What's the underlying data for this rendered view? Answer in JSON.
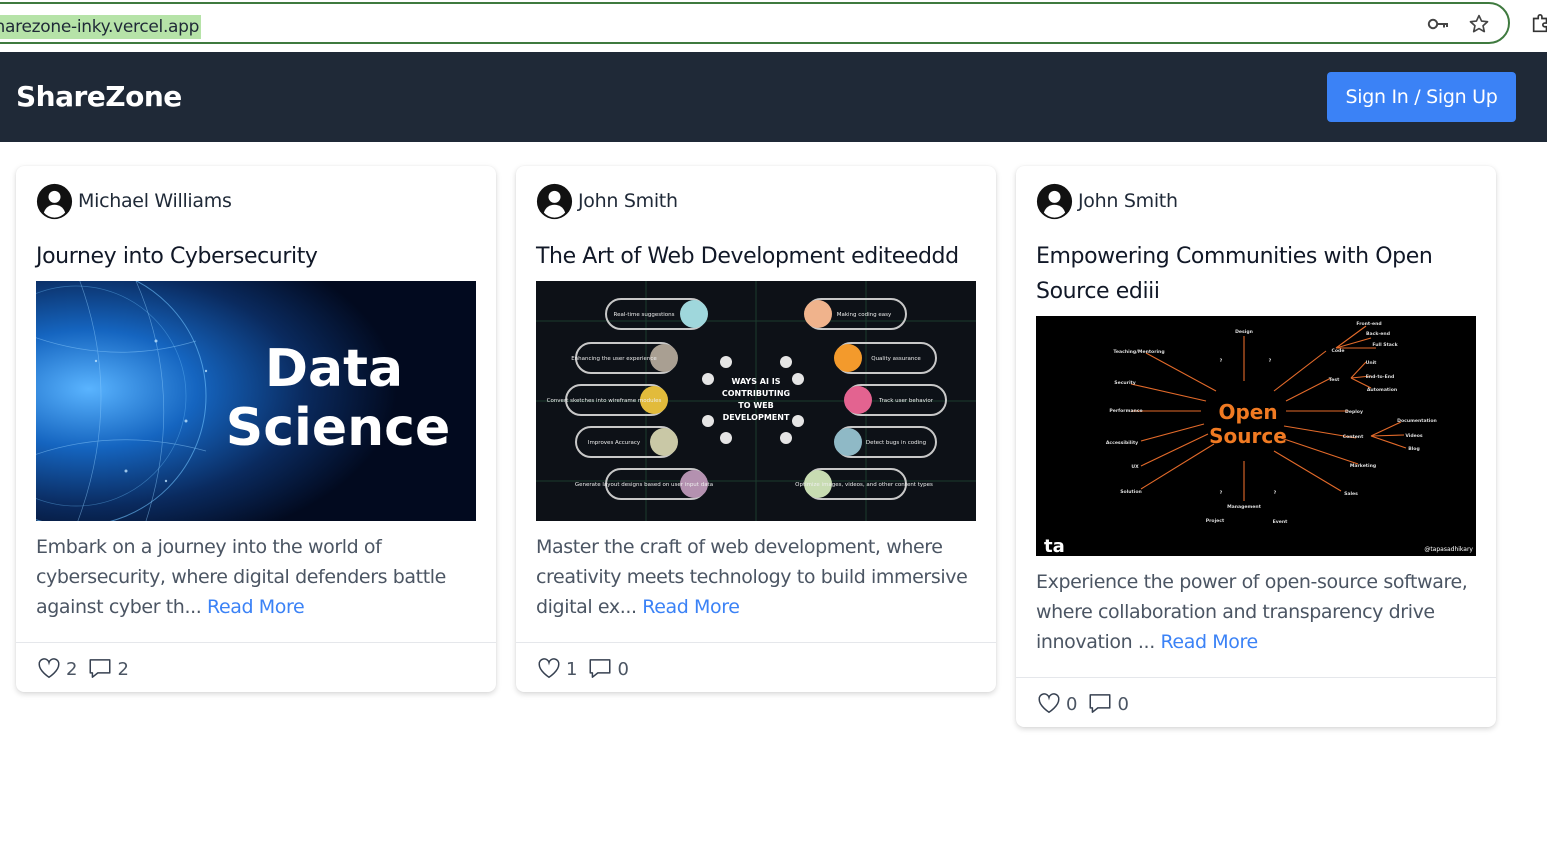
{
  "browser": {
    "url": "sharezone-inky.vercel.app",
    "icons": [
      "key-icon",
      "star-icon",
      "extensions-icon"
    ]
  },
  "header": {
    "brand": "ShareZone",
    "signin_label": "Sign In / Sign Up",
    "colors": {
      "background": "#1f2937",
      "button": "#3b82f6"
    }
  },
  "posts": [
    {
      "author": "Michael Williams",
      "title": "Journey into Cybersecurity",
      "image": {
        "headline_1": "Data",
        "headline_2": "Science"
      },
      "excerpt": "Embark on a journey into the world of cybersecurity, where digital defenders battle against cyber th...",
      "read_more": "Read More",
      "likes": "2",
      "comments": "2"
    },
    {
      "author": "John Smith",
      "title": "The Art of Web Development editeeddd",
      "image": {
        "center_1": "WAYS AI IS",
        "center_2": "CONTRIBUTING",
        "center_3": "TO WEB",
        "center_4": "DEVELOPMENT",
        "left_labels": [
          "Real-time suggestions",
          "Enhancing the user experience",
          "Convert sketches into wireframe modules",
          "Improves Accuracy",
          "Generate layout designs based on user input data"
        ],
        "right_labels": [
          "Making coding easy",
          "Quality assurance",
          "Track user behavior",
          "Detect bugs in coding",
          "Optimize images, videos, and other content types"
        ]
      },
      "excerpt": "Master the craft of web development, where creativity meets technology to build immersive digital ex...",
      "read_more": "Read More",
      "likes": "1",
      "comments": "0"
    },
    {
      "author": "John Smith",
      "title": "Empowering Communities with Open Source ediii",
      "image": {
        "center_1": "Open",
        "center_2": "Source",
        "labels": [
          "Design",
          "Teaching/Mentoring",
          "Security",
          "Performance",
          "Accessibility",
          "UX",
          "Solution",
          "Project",
          "Management",
          "Event",
          "Sales",
          "Marketing",
          "Content",
          "Deploy",
          "Test",
          "Code",
          "Front-end",
          "Back-end",
          "Full Stack",
          "Unit",
          "End-to-End",
          "Automation",
          "Documentation",
          "Videos",
          "Blog",
          "?"
        ],
        "logo": "ta",
        "handle": "@tapasadhikary"
      },
      "excerpt": "Experience the power of open-source software, where collaboration and transparency drive innovation ...",
      "read_more": "Read More",
      "likes": "0",
      "comments": "0"
    }
  ]
}
